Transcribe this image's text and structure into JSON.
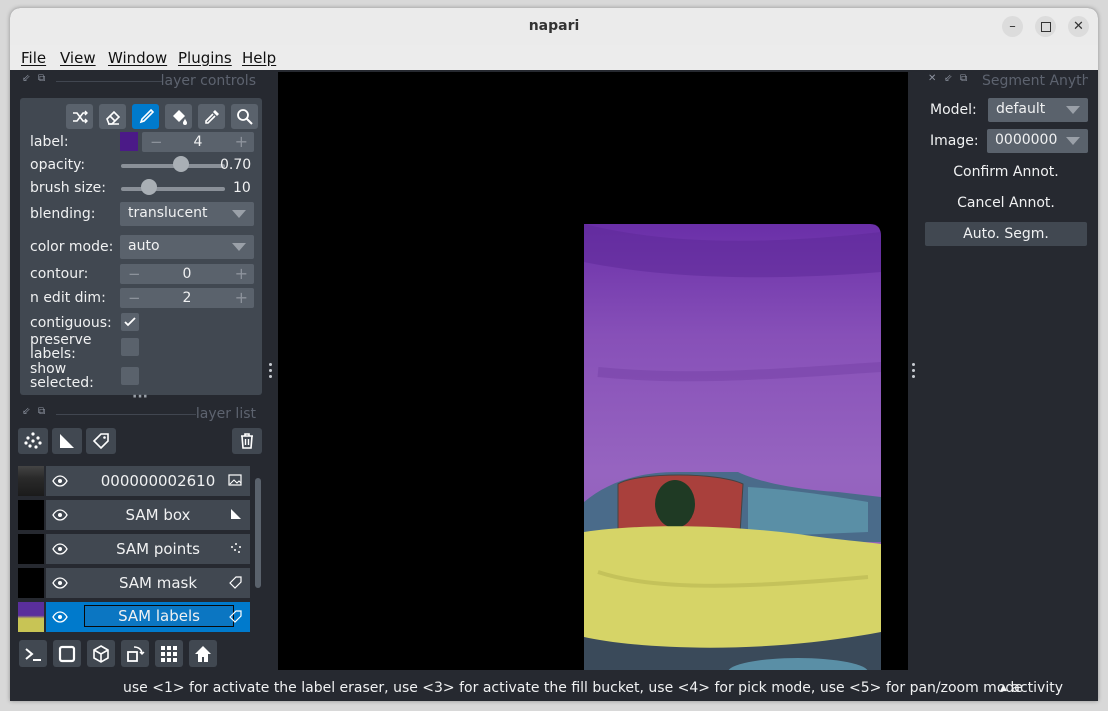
{
  "window": {
    "title": "napari"
  },
  "menubar": {
    "items": [
      "File",
      "View",
      "Window",
      "Plugins",
      "Help"
    ]
  },
  "layer_controls": {
    "header": "layer controls",
    "tools": [
      "shuffle-icon",
      "eraser-icon",
      "paintbrush-icon",
      "fill-bucket-icon",
      "color-picker-icon",
      "zoom-icon"
    ],
    "label": {
      "text": "label:",
      "value": "4",
      "color": "#4b1a87"
    },
    "opacity": {
      "text": "opacity:",
      "value": "0.70",
      "fraction": 0.7
    },
    "brush_size": {
      "text": "brush size:",
      "value": "10",
      "fraction": 0.27
    },
    "blending": {
      "text": "blending:",
      "value": "translucent"
    },
    "color_mode": {
      "text": "color mode:",
      "value": "auto"
    },
    "contour": {
      "text": "contour:",
      "value": "0"
    },
    "n_edit_dim": {
      "text": "n edit dim:",
      "value": "2"
    },
    "contiguous": {
      "text": "contiguous:",
      "checked": true
    },
    "preserve_labels": {
      "text": "preserve labels:",
      "checked": false
    },
    "show_selected": {
      "text": "show selected:",
      "checked": false
    }
  },
  "layer_list": {
    "header": "layer list",
    "layers": [
      {
        "name": "000000002610",
        "type_icon": "image-icon"
      },
      {
        "name": "SAM box",
        "type_icon": "shapes-icon"
      },
      {
        "name": "SAM points",
        "type_icon": "points-icon"
      },
      {
        "name": "SAM mask",
        "type_icon": "labels-icon"
      },
      {
        "name": "SAM labels",
        "type_icon": "labels-icon",
        "selected": true
      }
    ]
  },
  "right_panel": {
    "header": "Segment Anything",
    "model_label": "Model:",
    "model_value": "default",
    "image_label": "Image:",
    "image_value": "0000000",
    "confirm_button": "Confirm Annot.",
    "cancel_button": "Cancel Annot.",
    "auto_button": "Auto. Segm."
  },
  "statusbar": {
    "help_text": "use <1> for activate the label eraser, use <3> for activate the fill bucket, use <4> for pick mode, use <5> for pan/zoom mode",
    "activity": "activity"
  },
  "colors": {
    "accent": "#007acc",
    "panel": "#414851",
    "background": "#262930",
    "overlay_purple": "#8b57b8",
    "overlay_yellow": "#d6d467",
    "overlay_red": "#a9403c",
    "overlay_blue": "#5a8fa6"
  }
}
